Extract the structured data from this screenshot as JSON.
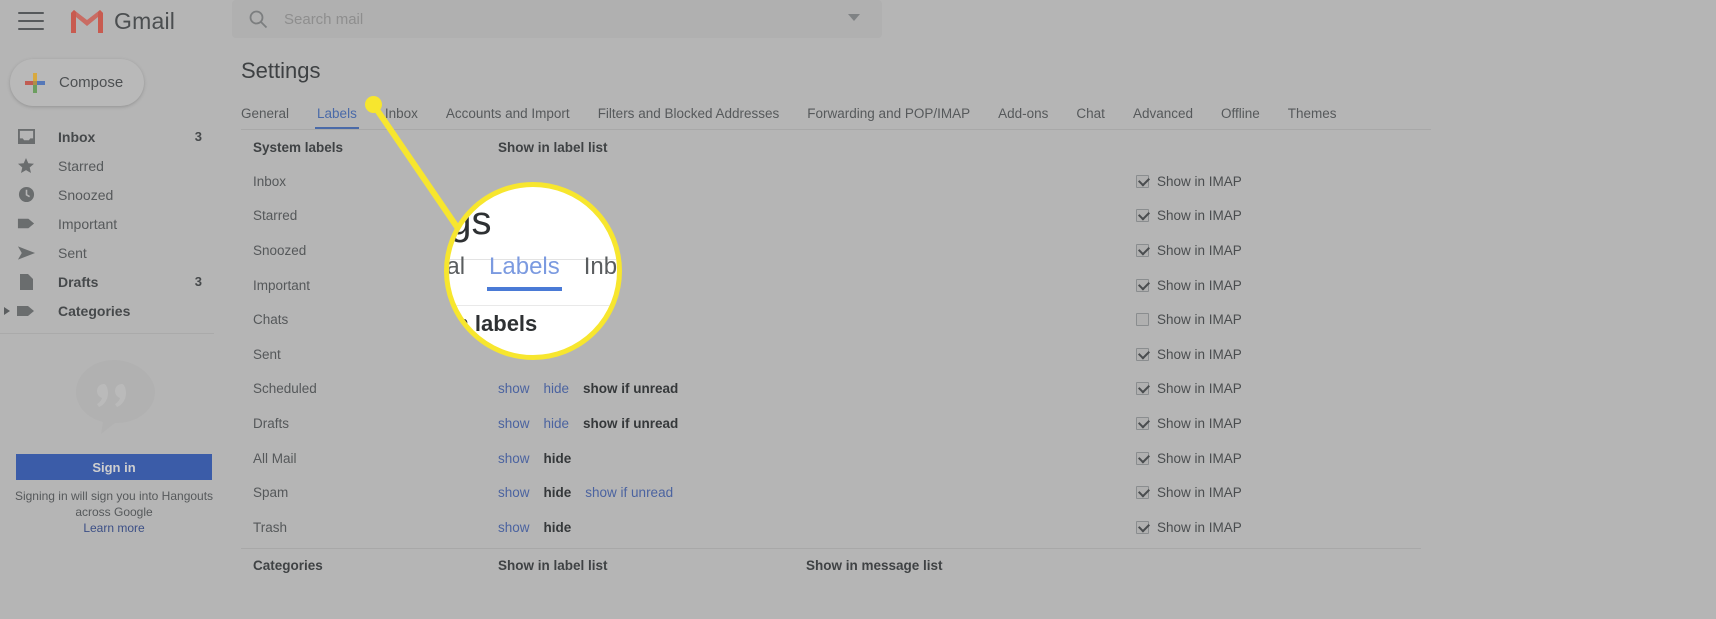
{
  "topbar": {
    "menu_icon": "hamburger-icon",
    "logo_text": "Gmail",
    "search_placeholder": "Search mail",
    "search_value": "",
    "search_options_icon": "chevron-down-icon"
  },
  "sidebar": {
    "compose_label": "Compose",
    "items": [
      {
        "label": "Inbox",
        "count": "3",
        "icon": "inbox-icon",
        "bold": true,
        "expandable": false
      },
      {
        "label": "Starred",
        "count": "",
        "icon": "star-icon",
        "bold": false,
        "expandable": false
      },
      {
        "label": "Snoozed",
        "count": "",
        "icon": "clock-icon",
        "bold": false,
        "expandable": false
      },
      {
        "label": "Important",
        "count": "",
        "icon": "important-tag-icon",
        "bold": false,
        "expandable": false
      },
      {
        "label": "Sent",
        "count": "",
        "icon": "send-icon",
        "bold": false,
        "expandable": false
      },
      {
        "label": "Drafts",
        "count": "3",
        "icon": "draft-page-icon",
        "bold": true,
        "expandable": false
      },
      {
        "label": "Categories",
        "count": "",
        "icon": "label-tag-icon",
        "bold": true,
        "expandable": true
      }
    ],
    "hangouts": {
      "icon": "hangouts-quote-icon",
      "signin_label": "Sign in",
      "note_line1": "Signing in will sign you into Hangouts",
      "note_line2": "across Google",
      "learn_more": "Learn more"
    }
  },
  "main": {
    "page_title": "Settings",
    "tabs": [
      {
        "label": "General",
        "active": false
      },
      {
        "label": "Labels",
        "active": true
      },
      {
        "label": "Inbox",
        "active": false
      },
      {
        "label": "Accounts and Import",
        "active": false
      },
      {
        "label": "Filters and Blocked Addresses",
        "active": false
      },
      {
        "label": "Forwarding and POP/IMAP",
        "active": false
      },
      {
        "label": "Add-ons",
        "active": false
      },
      {
        "label": "Chat",
        "active": false
      },
      {
        "label": "Advanced",
        "active": false
      },
      {
        "label": "Offline",
        "active": false
      },
      {
        "label": "Themes",
        "active": false
      }
    ],
    "system_labels": {
      "col_name": "System labels",
      "col_show_in_label_list": "Show in label list",
      "col_imap": "Show in IMAP",
      "rows": [
        {
          "name": "Inbox",
          "actions": [],
          "imap": "Show in IMAP",
          "imap_checked": true
        },
        {
          "name": "Starred",
          "actions": [],
          "imap": "Show in IMAP",
          "imap_checked": true
        },
        {
          "name": "Snoozed",
          "actions": [],
          "imap": "Show in IMAP",
          "imap_checked": true
        },
        {
          "name": "Important",
          "actions": [],
          "imap": "Show in IMAP",
          "imap_checked": true
        },
        {
          "name": "Chats",
          "actions": [],
          "imap": "Show in IMAP",
          "imap_checked": false
        },
        {
          "name": "Sent",
          "actions": [],
          "imap": "Show in IMAP",
          "imap_checked": true
        },
        {
          "name": "Scheduled",
          "actions": [
            {
              "label": "show",
              "selected": false
            },
            {
              "label": "hide",
              "selected": false
            },
            {
              "label": "show if unread",
              "selected": true
            }
          ],
          "imap": "Show in IMAP",
          "imap_checked": true
        },
        {
          "name": "Drafts",
          "actions": [
            {
              "label": "show",
              "selected": false
            },
            {
              "label": "hide",
              "selected": false
            },
            {
              "label": "show if unread",
              "selected": true
            }
          ],
          "imap": "Show in IMAP",
          "imap_checked": true
        },
        {
          "name": "All Mail",
          "actions": [
            {
              "label": "show",
              "selected": false
            },
            {
              "label": "hide",
              "selected": true
            }
          ],
          "imap": "Show in IMAP",
          "imap_checked": true
        },
        {
          "name": "Spam",
          "actions": [
            {
              "label": "show",
              "selected": false
            },
            {
              "label": "hide",
              "selected": true
            },
            {
              "label": "show if unread",
              "selected": false
            }
          ],
          "imap": "Show in IMAP",
          "imap_checked": true
        },
        {
          "name": "Trash",
          "actions": [
            {
              "label": "show",
              "selected": false
            },
            {
              "label": "hide",
              "selected": true
            }
          ],
          "imap": "Show in IMAP",
          "imap_checked": true
        }
      ]
    },
    "categories": {
      "col_name": "Categories",
      "col_show_in_label_list": "Show in label list",
      "col_show_in_message_list": "Show in message list"
    }
  },
  "callout": {
    "magnified_title": "ngs",
    "magnified_tabs": [
      {
        "label": "eral",
        "active": false
      },
      {
        "label": "Labels",
        "active": true
      },
      {
        "label": "Inbo",
        "active": false
      }
    ],
    "magnified_section": "em labels",
    "highlight_color": "#f7e62e"
  }
}
